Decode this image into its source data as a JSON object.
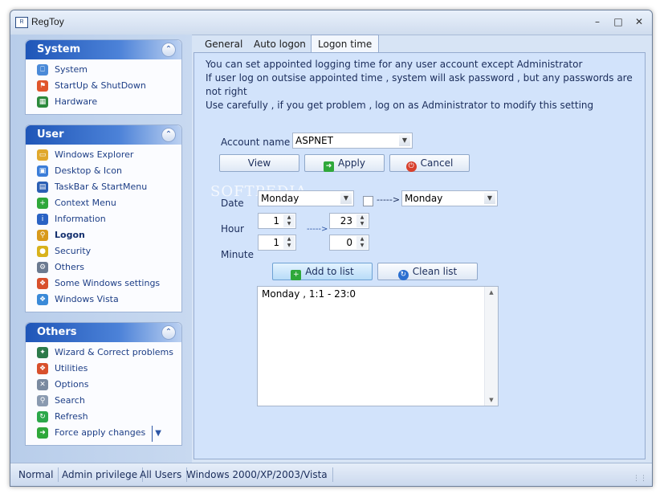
{
  "window": {
    "title": "RegToy",
    "app_icon_text": "R"
  },
  "sidebar": {
    "panels": [
      {
        "title": "System",
        "items": [
          {
            "label": "System",
            "icon": "computer-icon",
            "color": "#4a8ad8"
          },
          {
            "label": "StartUp & ShutDown",
            "icon": "windows-flag-icon",
            "color": "#e0562c"
          },
          {
            "label": "Hardware",
            "icon": "circuit-board-icon",
            "color": "#2c8a3c"
          }
        ]
      },
      {
        "title": "User",
        "items": [
          {
            "label": "Windows Explorer",
            "icon": "folder-icon",
            "color": "#e0a82c"
          },
          {
            "label": "Desktop & Icon",
            "icon": "desktop-icon",
            "color": "#3b7dd8"
          },
          {
            "label": "TaskBar & StartMenu",
            "icon": "taskbar-icon",
            "color": "#2b5fb4"
          },
          {
            "label": "Context Menu",
            "icon": "plus-icon",
            "color": "#2fa83a"
          },
          {
            "label": "Information",
            "icon": "info-icon",
            "color": "#2a63c4"
          },
          {
            "label": "Logon",
            "icon": "key-icon",
            "color": "#d89a1c"
          },
          {
            "label": "Security",
            "icon": "lock-icon",
            "color": "#d8b21c"
          },
          {
            "label": "Others",
            "icon": "gear-icon",
            "color": "#6b7a90"
          },
          {
            "label": "Some Windows settings",
            "icon": "windows-logo-icon",
            "color": "#d8502c"
          },
          {
            "label": "Windows Vista",
            "icon": "windows-logo-icon",
            "color": "#3a8ad8"
          }
        ]
      },
      {
        "title": "Others",
        "items": [
          {
            "label": "Wizard & Correct problems",
            "icon": "wizard-icon",
            "color": "#2c7a4a"
          },
          {
            "label": "Utilities",
            "icon": "windows-logo-icon",
            "color": "#d8502c"
          },
          {
            "label": "Options",
            "icon": "tools-icon",
            "color": "#7a8aa0"
          },
          {
            "label": "Search",
            "icon": "search-icon",
            "color": "#8a9ab0"
          },
          {
            "label": "Refresh",
            "icon": "refresh-icon",
            "color": "#2ca84a"
          },
          {
            "label": "Force apply changes",
            "icon": "apply-arrow-icon",
            "color": "#2fa83a"
          }
        ]
      }
    ]
  },
  "tabs": [
    "General",
    "Auto logon",
    "Logon time"
  ],
  "active_tab": "Logon time",
  "logon_time": {
    "info_lines": [
      "You can set appointed logging time for any user account except Administrator",
      "If user log on outsise appointed time , system will ask password , but any passwords are not right",
      "Use carefully , if you get problem , log on as Administrator to modify this setting"
    ],
    "account_label": "Account name",
    "account_value": "ASPNET",
    "view_button": "View",
    "apply_button": "Apply",
    "cancel_button": "Cancel",
    "date_label": "Date",
    "date_from": "Monday",
    "date_to": "Monday",
    "range_arrow": "----->",
    "hour_label": "Hour",
    "minute_label": "Minute",
    "hour_from": "1",
    "hour_to": "23",
    "minute_from": "1",
    "minute_to": "0",
    "add_button": "Add to list",
    "clean_button": "Clean list",
    "list_items": [
      "Monday , 1:1 - 23:0"
    ]
  },
  "watermark": "SOFTPEDIA",
  "status": [
    "Normal",
    "Admin privilege",
    "All Users",
    "Windows 2000/XP/2003/Vista"
  ]
}
